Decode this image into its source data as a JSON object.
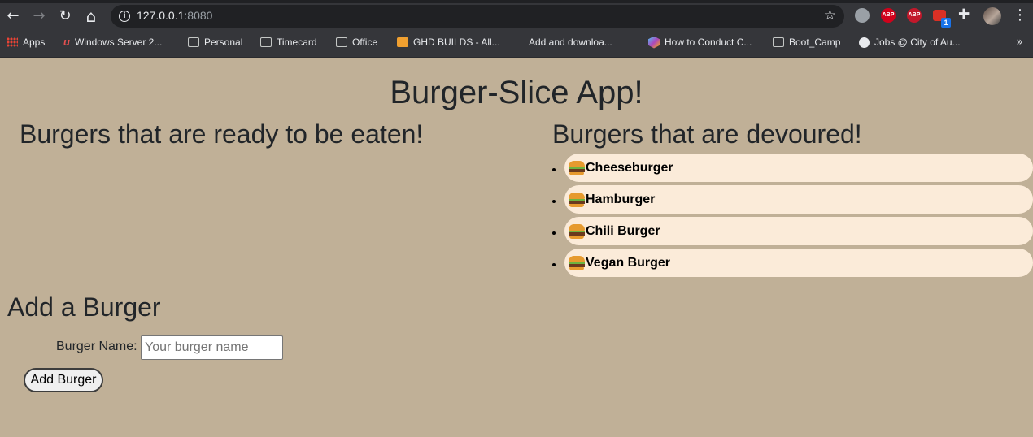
{
  "browser": {
    "url_host": "127.0.0.1",
    "url_port": ":8080",
    "bookmarks": [
      "Apps",
      "Windows Server 2...",
      "Personal",
      "Timecard",
      "Office",
      "GHD BUILDS - All...",
      "Add and downloa...",
      "How to Conduct C...",
      "Boot_Camp",
      "Jobs @ City of Au..."
    ],
    "extensions": {
      "abp": "ABP",
      "abp2": "ABP",
      "badge": "1"
    },
    "icons": {
      "back": "←",
      "forward": "→",
      "reload": "↻",
      "home": "⌂",
      "star": "☆",
      "puzzle": "✚",
      "menu": "⋮",
      "overflow": "»"
    }
  },
  "page": {
    "title": "Burger-Slice App!",
    "ready_heading": "Burgers that are ready to be eaten!",
    "devoured_heading": "Burgers that are devoured!",
    "devoured": [
      "Cheeseburger",
      "Hamburger",
      "Chili Burger",
      "Vegan Burger"
    ],
    "form": {
      "heading": "Add a Burger",
      "label": "Burger Name:",
      "placeholder": "Your burger name",
      "value": "",
      "button": "Add Burger"
    }
  }
}
